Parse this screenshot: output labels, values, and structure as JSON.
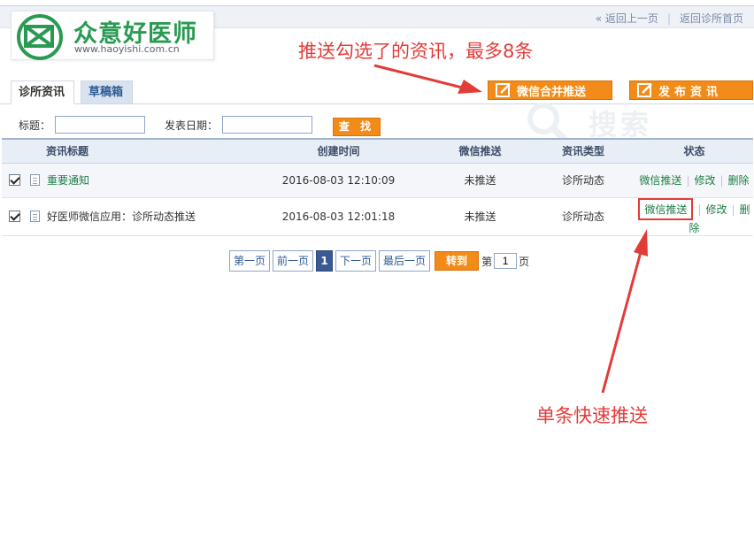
{
  "top_links": {
    "back": "« 返回上一页",
    "separator": "|",
    "home": "返回诊所首页"
  },
  "logo": {
    "name": "众意好医师",
    "url": "www.haoyishi.com.cn"
  },
  "annotations": {
    "top": "推送勾选了的资讯，最多8条",
    "bottom": "单条快速推送",
    "color": "#e23c39"
  },
  "buttons": {
    "merge_push": "微信合并推送",
    "publish": "发布资讯"
  },
  "tabs": [
    {
      "label": "诊所资讯",
      "active": true
    },
    {
      "label": "草稿箱",
      "active": false
    }
  ],
  "search": {
    "title_label": "标题：",
    "title_value": "",
    "date_label": "发表日期：",
    "date_value": "",
    "button": "查 找",
    "watermark": "搜索"
  },
  "table": {
    "headers": [
      "资讯标题",
      "创建时间",
      "微信推送",
      "资讯类型",
      "状态"
    ],
    "rows": [
      {
        "checked": true,
        "title": "重要通知",
        "created": "2016-08-03 12:10:09",
        "push": "未推送",
        "type": "诊所动态",
        "op_push": "微信推送",
        "op_edit": "修改",
        "op_delete": "删除"
      },
      {
        "checked": true,
        "title": "好医师微信应用：诊所动态推送",
        "created": "2016-08-03 12:01:18",
        "push": "未推送",
        "type": "诊所动态",
        "op_push": "微信推送",
        "op_edit": "修改",
        "op_delete": "删除"
      }
    ]
  },
  "pager": {
    "first": "第一页",
    "prev": "前一页",
    "current": "1",
    "next": "下一页",
    "last": "最后一页",
    "go": "转到",
    "page_prefix": "第",
    "page_value": "1",
    "page_suffix": "页"
  },
  "colors": {
    "brand_green": "#2a9a52",
    "accent_orange": "#f28b17",
    "link_green": "#1d7d45",
    "header_blue": "#3b5a94"
  }
}
